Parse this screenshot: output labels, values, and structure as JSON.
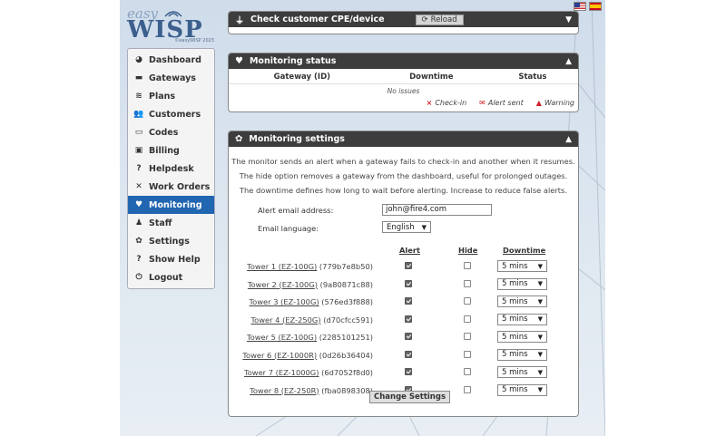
{
  "logo": {
    "easy": "easy",
    "wisp": "WISP",
    "copyright": "©easyWISP 2023"
  },
  "flags": [
    {
      "name": "us-flag-icon"
    },
    {
      "name": "es-flag-icon"
    }
  ],
  "sidebar": {
    "items": [
      {
        "label": "Dashboard",
        "icon": "dashboard-icon",
        "glyph": "◕",
        "active": false
      },
      {
        "label": "Gateways",
        "icon": "gateway-icon",
        "glyph": "▬",
        "active": false
      },
      {
        "label": "Plans",
        "icon": "plans-icon",
        "glyph": "≋",
        "active": false
      },
      {
        "label": "Customers",
        "icon": "customers-icon",
        "glyph": "👥",
        "active": false
      },
      {
        "label": "Codes",
        "icon": "codes-icon",
        "glyph": "▭",
        "active": false
      },
      {
        "label": "Billing",
        "icon": "billing-icon",
        "glyph": "▣",
        "active": false
      },
      {
        "label": "Helpdesk",
        "icon": "helpdesk-icon",
        "glyph": "?",
        "active": false
      },
      {
        "label": "Work Orders",
        "icon": "tools-icon",
        "glyph": "✕",
        "active": false
      },
      {
        "label": "Monitoring",
        "icon": "heartbeat-icon",
        "glyph": "♥",
        "active": true
      },
      {
        "label": "Staff",
        "icon": "staff-icon",
        "glyph": "♟",
        "active": false
      },
      {
        "label": "Settings",
        "icon": "gear-icon",
        "glyph": "✿",
        "active": false
      },
      {
        "label": "Show Help",
        "icon": "question-icon",
        "glyph": "?",
        "active": false
      },
      {
        "label": "Logout",
        "icon": "power-icon",
        "glyph": "⏻",
        "active": false
      }
    ]
  },
  "cpe_panel": {
    "title": "Check customer CPE/device",
    "reload_label": "Reload"
  },
  "status_panel": {
    "title": "Monitoring status",
    "columns": [
      "Gateway (ID)",
      "Downtime",
      "Status"
    ],
    "empty_text": "No issues",
    "legend": {
      "checkin": "Check-in",
      "alert": "Alert sent",
      "warning": "Warning"
    }
  },
  "settings_panel": {
    "title": "Monitoring settings",
    "intro": [
      "The monitor sends an alert when a gateway fails to check-in and another when it resumes.",
      "The hide option removes a gateway from the dashboard, useful for prolonged outages.",
      "The downtime defines how long to wait before alerting. Increase to reduce false alerts."
    ],
    "email_label": "Alert email address:",
    "email_value": "john@fire4.com",
    "language_label": "Email language:",
    "language_value": "English",
    "columns": {
      "alert": "Alert",
      "hide": "Hide",
      "downtime": "Downtime"
    },
    "towers": [
      {
        "name": "Tower 1",
        "model": "EZ-100G",
        "id": "(779b7e8b50)",
        "alert": true,
        "hide": false,
        "downtime": "5 mins"
      },
      {
        "name": "Tower 2",
        "model": "EZ-100G",
        "id": "(9a80871c88)",
        "alert": true,
        "hide": false,
        "downtime": "5 mins"
      },
      {
        "name": "Tower 3",
        "model": "EZ-100G",
        "id": "(576ed3f888)",
        "alert": true,
        "hide": false,
        "downtime": "5 mins"
      },
      {
        "name": "Tower 4",
        "model": "EZ-250G",
        "id": "(d70cfcc591)",
        "alert": true,
        "hide": false,
        "downtime": "5 mins"
      },
      {
        "name": "Tower 5",
        "model": "EZ-100G",
        "id": "(2285101251)",
        "alert": true,
        "hide": false,
        "downtime": "5 mins"
      },
      {
        "name": "Tower 6",
        "model": "EZ-1000R",
        "id": "(0d26b36404)",
        "alert": true,
        "hide": false,
        "downtime": "5 mins"
      },
      {
        "name": "Tower 7",
        "model": "EZ-1000G",
        "id": "(6d7052f8d0)",
        "alert": true,
        "hide": false,
        "downtime": "5 mins"
      },
      {
        "name": "Tower 8",
        "model": "EZ-250R",
        "id": "(fba0898308)",
        "alert": true,
        "hide": false,
        "downtime": "5 mins"
      }
    ],
    "submit_label": "Change Settings"
  },
  "colors": {
    "accent": "#2166b0",
    "header": "#3d3d3d",
    "alert_red": "#d0202a"
  }
}
